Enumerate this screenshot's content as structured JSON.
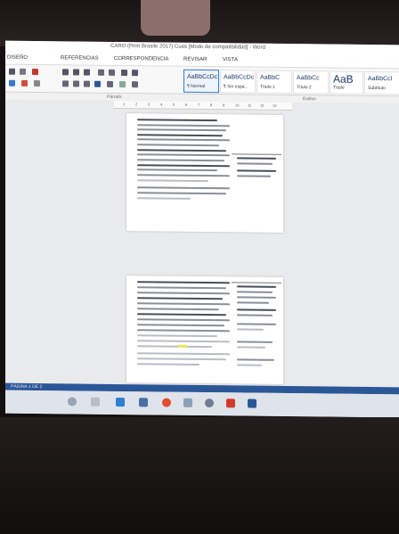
{
  "window": {
    "title": "CARO (Prim Brasile 2017) Cues [Modo de compatibilidad] - Word"
  },
  "ribbon_tabs": [
    {
      "label": "DISEÑO"
    },
    {
      "label": "REFERENCIAS"
    },
    {
      "label": "CORRESPONDENCIA"
    },
    {
      "label": "REVISAR"
    },
    {
      "label": "VISTA"
    }
  ],
  "styles": [
    {
      "sample": "AaBbCcDc",
      "name": "¶ Normal"
    },
    {
      "sample": "AaBbCcDc",
      "name": "¶ Sin espa..."
    },
    {
      "sample": "AaBbC",
      "name": "Título 1"
    },
    {
      "sample": "AaBbCc",
      "name": "Título 2"
    },
    {
      "sample": "AaB",
      "name": "Título"
    },
    {
      "sample": "AaBbCcl",
      "name": "Subtítulo"
    }
  ],
  "groups": {
    "paragraph": "Párrafo",
    "styles": "Estilos"
  },
  "ruler_numbers": [
    "1",
    "2",
    "3",
    "4",
    "5",
    "6",
    "7",
    "8",
    "9",
    "10",
    "11",
    "12",
    "13"
  ],
  "statusbar": {
    "text": "PÁGINA 1 DE 2"
  },
  "colors": {
    "accent": "#2b5797",
    "selected_style": "#3a78c8",
    "highlight": "#f1e45a"
  }
}
